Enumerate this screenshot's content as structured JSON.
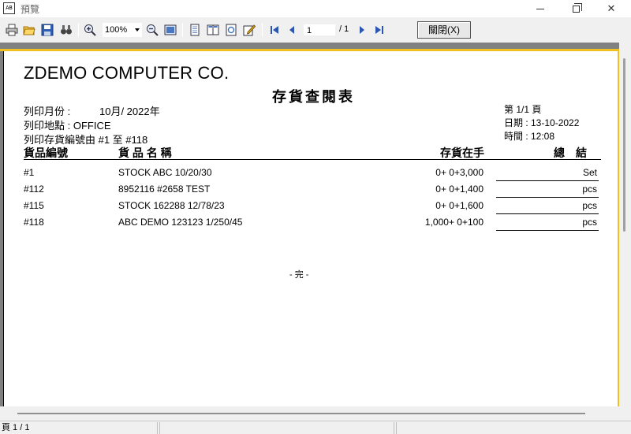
{
  "window": {
    "title": "預覽",
    "app_icon_text": "AB"
  },
  "toolbar": {
    "icons": [
      "print-icon",
      "open-icon",
      "save-icon",
      "find-icon",
      "zoom-in-icon",
      "zoom-out-icon",
      "fit-page-icon",
      "single-page-icon",
      "two-page-icon",
      "export-icon",
      "edit-icon",
      "first-page-icon",
      "prev-page-icon",
      "next-page-icon",
      "last-page-icon"
    ],
    "zoom_value": "100%",
    "page_value": "1",
    "page_total": "/ 1",
    "close_label": "關閉(X)"
  },
  "report": {
    "company": "ZDEMO COMPUTER CO.",
    "title": "存貨查閱表",
    "print_month_label": "列印月份 :",
    "print_month_value": "10月/ 2022年",
    "print_location": "列印地點 : OFFICE",
    "print_range": "列印存貨編號由 #1 至 #118",
    "page_info": "第 1/1 頁",
    "date_info": "日期 : 13-10-2022",
    "time_info": "時間 : 12:08",
    "columns": {
      "code": "貨品編號",
      "name": "貨 品 名 稱",
      "stock": "存貨在手",
      "total": "總　結"
    },
    "rows": [
      {
        "code": "#1",
        "name": "STOCK ABC 10/20/30",
        "stock": "0+ 0+3,000",
        "unit": "Set"
      },
      {
        "code": "#112",
        "name": "8952116 #2658 TEST",
        "stock": "0+ 0+1,400",
        "unit": "pcs"
      },
      {
        "code": "#115",
        "name": "STOCK 162288  12/78/23",
        "stock": "0+ 0+1,600",
        "unit": "pcs"
      },
      {
        "code": "#118",
        "name": "ABC DEMO 123123 1/250/45",
        "stock": "1,000+ 0+100",
        "unit": "pcs"
      }
    ],
    "end_mark": "- 完 -"
  },
  "status": {
    "page": "頁 1 / 1"
  }
}
